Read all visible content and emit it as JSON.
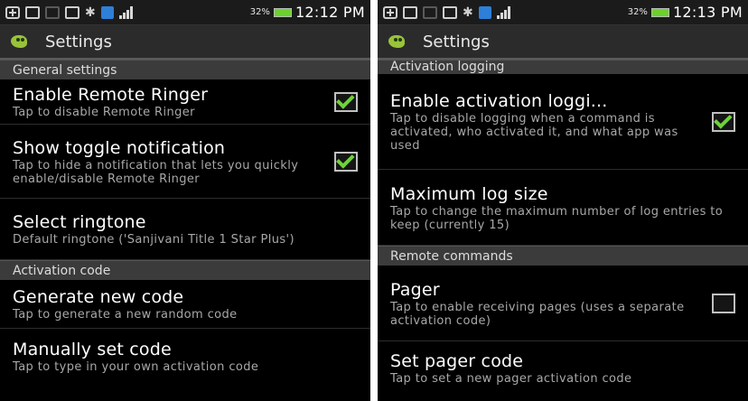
{
  "left": {
    "status": {
      "battery_pct": "32%",
      "time": "12:12 PM"
    },
    "title": "Settings",
    "sections": [
      {
        "header": "General settings",
        "items": [
          {
            "title": "Enable Remote Ringer",
            "summary": "Tap to disable Remote Ringer",
            "checkbox": true,
            "checked": true
          },
          {
            "title": "Show toggle notification",
            "summary": "Tap to hide a notification that lets you quickly enable/disable Remote Ringer",
            "checkbox": true,
            "checked": true
          },
          {
            "title": "Select ringtone",
            "summary": "Default ringtone ('Sanjivani Title 1 Star Plus')",
            "checkbox": false
          }
        ]
      },
      {
        "header": "Activation code",
        "items": [
          {
            "title": "Generate new code",
            "summary": "Tap to generate a new random code",
            "checkbox": false
          },
          {
            "title": "Manually set code",
            "summary": "Tap to type in your own activation code",
            "checkbox": false
          }
        ]
      }
    ]
  },
  "right": {
    "status": {
      "battery_pct": "32%",
      "time": "12:13 PM"
    },
    "title": "Settings",
    "sections": [
      {
        "header": "Activation logging",
        "items": [
          {
            "title": "Enable activation loggi...",
            "summary": "Tap to disable logging when a command is activated, who activated it, and what app was used",
            "checkbox": true,
            "checked": true
          },
          {
            "title": "Maximum log size",
            "summary": "Tap to change the maximum number of log entries to keep (currently 15)",
            "checkbox": false
          }
        ]
      },
      {
        "header": "Remote commands",
        "items": [
          {
            "title": "Pager",
            "summary": "Tap to enable receiving pages (uses a separate activation code)",
            "checkbox": true,
            "checked": false
          },
          {
            "title": "Set pager code",
            "summary": "Tap to set a new pager activation code",
            "checkbox": false
          }
        ]
      }
    ]
  }
}
